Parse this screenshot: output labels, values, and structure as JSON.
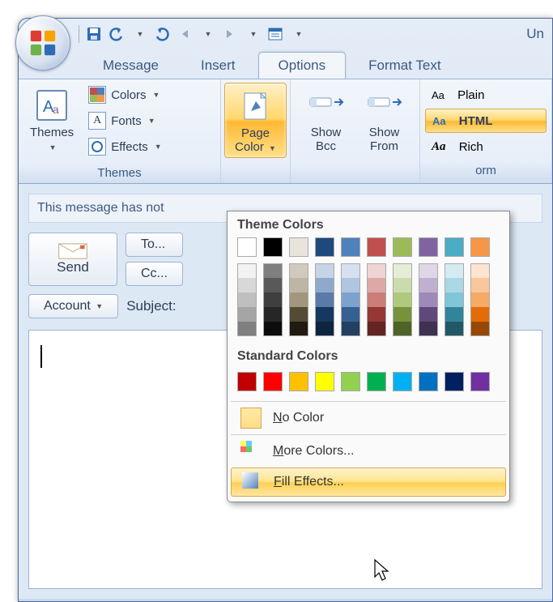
{
  "title": "Un",
  "tabs": {
    "message": "Message",
    "insert": "Insert",
    "options": "Options",
    "format": "Format Text"
  },
  "ribbon": {
    "themes_group": "Themes",
    "themes_btn": "Themes",
    "colors": "Colors",
    "fonts": "Fonts",
    "effects": "Effects",
    "page_color": "Page\nColor",
    "show_bcc": "Show\nBcc",
    "show_from": "Show\nFrom",
    "plain": "Plain",
    "html": "HTML",
    "rich": "Rich",
    "orm": "orm"
  },
  "msg": {
    "info": "This message has not",
    "send": "Send",
    "to": "To...",
    "cc": "Cc...",
    "account": "Account",
    "subject": "Subject:"
  },
  "menu": {
    "theme_title": "Theme Colors",
    "standard_title": "Standard Colors",
    "no_color": "o Color",
    "no_color_pre": "N",
    "more": "ore Colors...",
    "more_pre": "M",
    "fill": "ill Effects...",
    "fill_pre": "F"
  },
  "chart_data": {
    "theme_top": [
      "#ffffff",
      "#000000",
      "#e8e4dc",
      "#1f497d",
      "#4f81bd",
      "#c0504d",
      "#9bbb59",
      "#8064a2",
      "#4bacc6",
      "#f79646"
    ],
    "theme_shades": [
      [
        "#f2f2f2",
        "#7f7f7f",
        "#d0cabe",
        "#c6d4e5",
        "#d6e0ef",
        "#efd4d3",
        "#e5edd7",
        "#dfd7e7",
        "#d5ebf1",
        "#fce4d0"
      ],
      [
        "#d8d8d8",
        "#595959",
        "#beb6a4",
        "#8fa9cc",
        "#afc5e0",
        "#dda9a7",
        "#cadcab",
        "#bfb0d0",
        "#abd8e5",
        "#f9c79b"
      ],
      [
        "#bfbfbf",
        "#3f3f3f",
        "#a2967c",
        "#5a7aa8",
        "#7da3cd",
        "#cb7d7a",
        "#afc97f",
        "#9f89b9",
        "#81c5d8",
        "#f5aa66"
      ],
      [
        "#a5a5a5",
        "#262626",
        "#544b34",
        "#153860",
        "#376092",
        "#953734",
        "#76923c",
        "#5f497a",
        "#31859b",
        "#e36c09"
      ],
      [
        "#7f7f7f",
        "#0c0c0c",
        "#1f1b10",
        "#0f243e",
        "#244061",
        "#632423",
        "#4f6228",
        "#3f3151",
        "#205867",
        "#974806"
      ]
    ],
    "standard": [
      "#c00000",
      "#ff0000",
      "#ffc000",
      "#ffff00",
      "#92d050",
      "#00b050",
      "#00b0f0",
      "#0070c0",
      "#002060",
      "#7030a0"
    ]
  }
}
